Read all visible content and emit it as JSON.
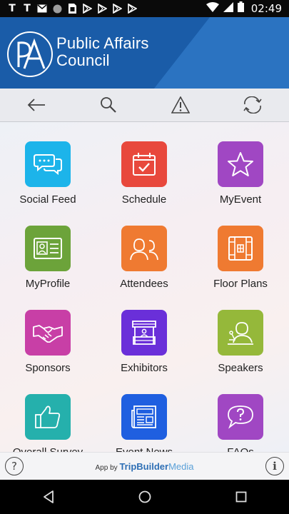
{
  "status_bar": {
    "left_icons": [
      "t-icon",
      "t-icon",
      "mail-icon",
      "circle-icon",
      "sim-icon",
      "play-icon",
      "play-icon",
      "play-icon",
      "play-icon"
    ],
    "t1": "T",
    "t2": "T",
    "time": "02:49"
  },
  "header": {
    "logo_text": "PA",
    "org_line1": "Public Affairs",
    "org_line2": "Council"
  },
  "toolbar": {
    "buttons": [
      "back-icon",
      "search-icon",
      "warning-icon",
      "refresh-icon"
    ]
  },
  "tiles": [
    {
      "label": "Social Feed",
      "color": "#1cb4ea",
      "icon": "chat-icon"
    },
    {
      "label": "Schedule",
      "color": "#e8483c",
      "icon": "calendar-icon"
    },
    {
      "label": "MyEvent",
      "color": "#a047c3",
      "icon": "star-icon"
    },
    {
      "label": "MyProfile",
      "color": "#6ca33a",
      "icon": "id-card-icon"
    },
    {
      "label": "Attendees",
      "color": "#ef7a31",
      "icon": "people-icon"
    },
    {
      "label": "Floor Plans",
      "color": "#ef7a31",
      "icon": "floor-plan-icon"
    },
    {
      "label": "Sponsors",
      "color": "#c83fa6",
      "icon": "handshake-icon"
    },
    {
      "label": "Exhibitors",
      "color": "#6a2fd9",
      "icon": "booth-icon"
    },
    {
      "label": "Speakers",
      "color": "#95b83a",
      "icon": "speaker-icon"
    },
    {
      "label": "Overall Survey",
      "color": "#25b0ac",
      "icon": "thumbs-up-icon"
    },
    {
      "label": "Event News",
      "color": "#1f5fe0",
      "icon": "news-icon"
    },
    {
      "label": "FAQs",
      "color": "#a047c3",
      "icon": "question-bubble-icon"
    }
  ],
  "footer": {
    "help": "?",
    "info": "i",
    "app_by": "App by",
    "brand_part1": "TripBuilder",
    "brand_part2": "Media"
  },
  "colors": {
    "header_blue": "#1a5ca8",
    "toolbar_bg": "#e9eaee"
  }
}
